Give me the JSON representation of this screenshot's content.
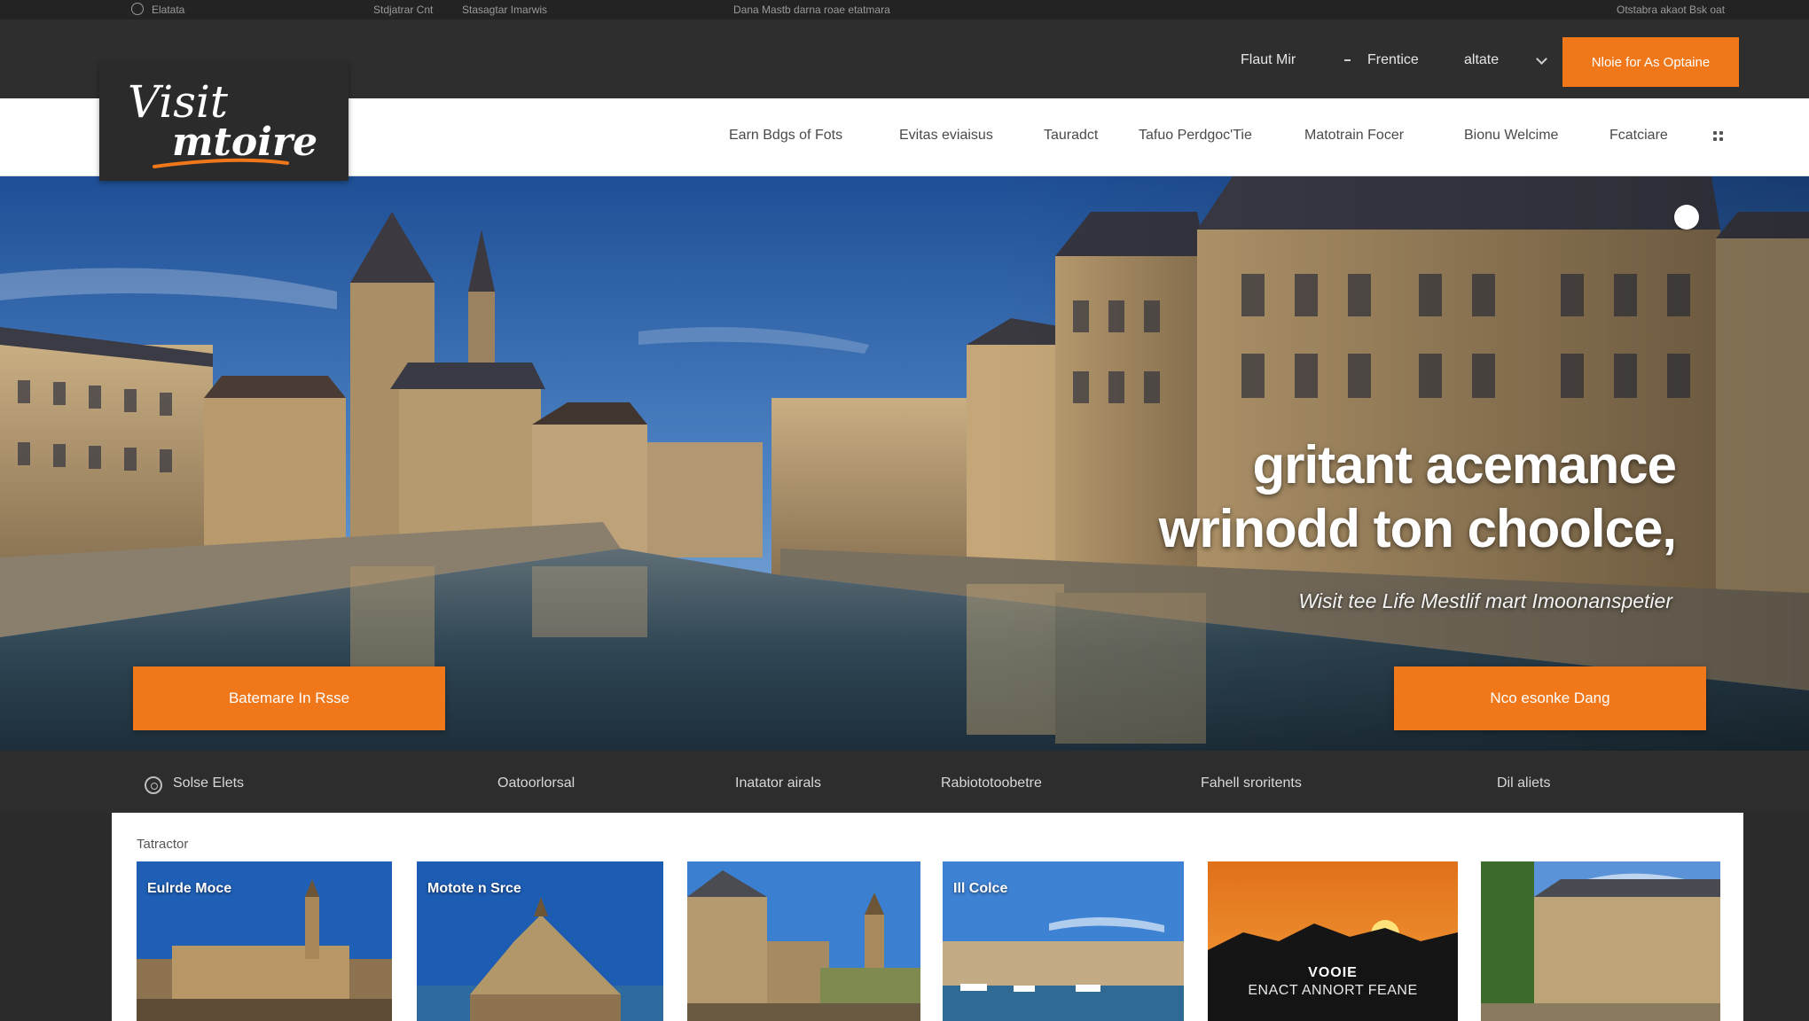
{
  "colors": {
    "accent": "#f0781a",
    "header_bg": "#2e2e2e",
    "nav_bg": "#ffffff"
  },
  "utility_bar": {
    "left_text": "Elatata",
    "links": [
      "Stdjatrar Cnt",
      "Stasagtar Imarwis"
    ],
    "center_text": "Dana Mastb darna roae etatmara",
    "right_text": "Otstabra akaot Bsk oat"
  },
  "logo": {
    "line1": "Visit",
    "line2": "mtoire"
  },
  "header": {
    "links": [
      "Flaut Mir",
      "Frentice",
      "altate"
    ],
    "cta_label": "Nloie for As Optaine"
  },
  "nav": {
    "items": [
      "Earn Bdgs of Fots",
      "Evitas eviaisus",
      "Tauradct",
      "Tafuo Perdgoc'Tie",
      "Matotrain Focer",
      "Bionu Welcime",
      "Fcatciare"
    ],
    "dots_icon": "grid-icon"
  },
  "hero": {
    "headline_line1": "gritant acemance",
    "headline_line2": "wrinodd ton choolce,",
    "subtitle": "Wisit tee Life Mestlif mart Imoonanspetier",
    "left_button": "Batemare In Rsse",
    "right_button": "Nco esonke Dang"
  },
  "categories": {
    "items": [
      "Solse Elets",
      "Oatoorlorsal",
      "Inatator airals",
      "Rabiototoobetre",
      "Fahell sroritents",
      "Dil aliets"
    ]
  },
  "cards_section": {
    "label": "Tatractor",
    "cards": [
      {
        "title": "Eulrde Moce"
      },
      {
        "title": "Motote n Srce"
      },
      {
        "title": ""
      },
      {
        "title": "Ill Colce"
      },
      {
        "title": "",
        "overlay_line1": "VOOIE",
        "overlay_line2": "ENACT ANNORT FEANE"
      },
      {
        "title": ""
      }
    ]
  }
}
